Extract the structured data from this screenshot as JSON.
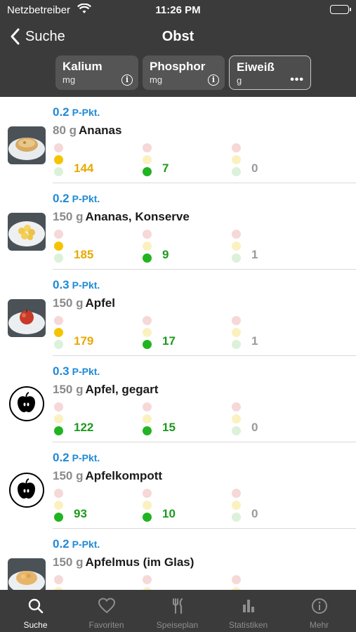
{
  "status": {
    "carrier": "Netzbetreiber",
    "time": "11:26 PM"
  },
  "nav": {
    "back_label": "Suche",
    "title": "Obst"
  },
  "segments": [
    {
      "name": "Kalium",
      "unit": "mg",
      "icon": "info-icon"
    },
    {
      "name": "Phosphor",
      "unit": "mg",
      "icon": "info-icon"
    },
    {
      "name": "Eiweiß",
      "unit": "g",
      "icon": "more-icon",
      "selected": true
    }
  ],
  "pkt_unit": "P-Pkt.",
  "items": [
    {
      "pkt": "0.2",
      "amount": "80 g",
      "name": "Ananas",
      "thumb": "pineapple-cake-photo",
      "values": [
        {
          "level": "yellow",
          "value": "144"
        },
        {
          "level": "green",
          "value": "7"
        },
        {
          "level": "none",
          "value": "0"
        }
      ]
    },
    {
      "pkt": "0.2",
      "amount": "150 g",
      "name": "Ananas, Konserve",
      "thumb": "canned-pineapple-photo",
      "values": [
        {
          "level": "yellow",
          "value": "185"
        },
        {
          "level": "green",
          "value": "9"
        },
        {
          "level": "none",
          "value": "1"
        }
      ]
    },
    {
      "pkt": "0.3",
      "amount": "150 g",
      "name": "Apfel",
      "thumb": "apple-photo",
      "values": [
        {
          "level": "yellow",
          "value": "179"
        },
        {
          "level": "green",
          "value": "17"
        },
        {
          "level": "none",
          "value": "1"
        }
      ]
    },
    {
      "pkt": "0.3",
      "amount": "150 g",
      "name": "Apfel, gegart",
      "thumb": "apple-icon",
      "values": [
        {
          "level": "green",
          "value": "122"
        },
        {
          "level": "green",
          "value": "15"
        },
        {
          "level": "none",
          "value": "0"
        }
      ]
    },
    {
      "pkt": "0.2",
      "amount": "150 g",
      "name": "Apfelkompott",
      "thumb": "apple-icon",
      "values": [
        {
          "level": "green",
          "value": "93"
        },
        {
          "level": "green",
          "value": "10"
        },
        {
          "level": "none",
          "value": "0"
        }
      ]
    },
    {
      "pkt": "0.2",
      "amount": "150 g",
      "name": "Apfelmus (im Glas)",
      "thumb": "applesauce-photo",
      "values": [
        {
          "level": "none",
          "value": ""
        },
        {
          "level": "none",
          "value": ""
        },
        {
          "level": "none",
          "value": ""
        }
      ]
    }
  ],
  "tabs": [
    {
      "label": "Suche",
      "icon": "search-icon",
      "active": true
    },
    {
      "label": "Favoriten",
      "icon": "heart-icon"
    },
    {
      "label": "Speiseplan",
      "icon": "fork-knife-icon"
    },
    {
      "label": "Statistiken",
      "icon": "bar-chart-icon"
    },
    {
      "label": "Mehr",
      "icon": "info-icon"
    }
  ],
  "colors": {
    "bar": "#3b3b3b",
    "accent": "#1f8ad6",
    "yellow": "#f5c400",
    "green": "#21b421"
  }
}
